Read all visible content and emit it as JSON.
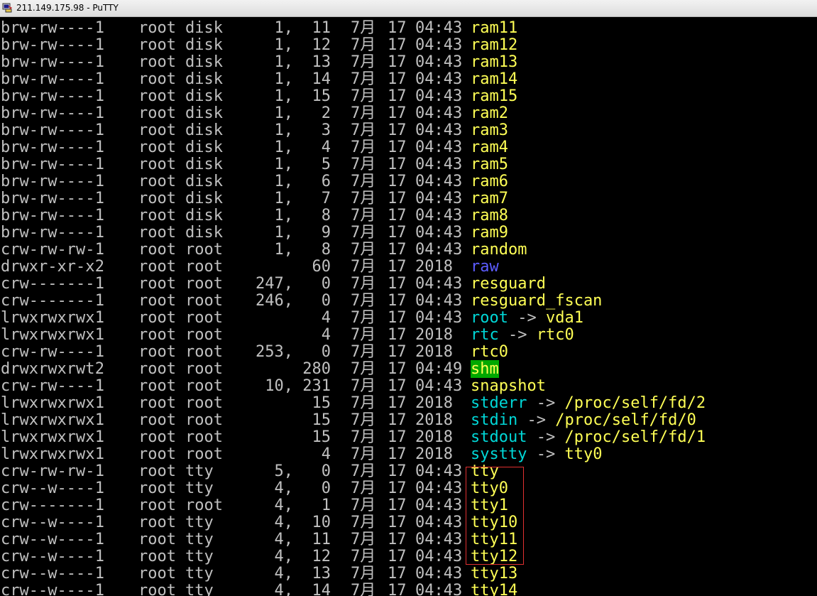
{
  "window": {
    "title": "211.149.175.98 - PuTTY",
    "icon": "putty-terminal-icon"
  },
  "colors": {
    "background": "#000000",
    "default_text": "#c0c0c0",
    "device_file": "#ffff55",
    "directory": "#5c5cff",
    "symlink": "#00d7d7",
    "sticky_dir_background": "#00a800",
    "highlight_box": "#e03030"
  },
  "listing": [
    {
      "perm": "brw-rw----",
      "links": "1",
      "owner": "root",
      "group": "disk",
      "size": "1,  11",
      "month": "7月",
      "day": "17",
      "time": "04:43",
      "name": "ram11",
      "type": "dev"
    },
    {
      "perm": "brw-rw----",
      "links": "1",
      "owner": "root",
      "group": "disk",
      "size": "1,  12",
      "month": "7月",
      "day": "17",
      "time": "04:43",
      "name": "ram12",
      "type": "dev"
    },
    {
      "perm": "brw-rw----",
      "links": "1",
      "owner": "root",
      "group": "disk",
      "size": "1,  13",
      "month": "7月",
      "day": "17",
      "time": "04:43",
      "name": "ram13",
      "type": "dev"
    },
    {
      "perm": "brw-rw----",
      "links": "1",
      "owner": "root",
      "group": "disk",
      "size": "1,  14",
      "month": "7月",
      "day": "17",
      "time": "04:43",
      "name": "ram14",
      "type": "dev"
    },
    {
      "perm": "brw-rw----",
      "links": "1",
      "owner": "root",
      "group": "disk",
      "size": "1,  15",
      "month": "7月",
      "day": "17",
      "time": "04:43",
      "name": "ram15",
      "type": "dev"
    },
    {
      "perm": "brw-rw----",
      "links": "1",
      "owner": "root",
      "group": "disk",
      "size": "1,   2",
      "month": "7月",
      "day": "17",
      "time": "04:43",
      "name": "ram2",
      "type": "dev"
    },
    {
      "perm": "brw-rw----",
      "links": "1",
      "owner": "root",
      "group": "disk",
      "size": "1,   3",
      "month": "7月",
      "day": "17",
      "time": "04:43",
      "name": "ram3",
      "type": "dev"
    },
    {
      "perm": "brw-rw----",
      "links": "1",
      "owner": "root",
      "group": "disk",
      "size": "1,   4",
      "month": "7月",
      "day": "17",
      "time": "04:43",
      "name": "ram4",
      "type": "dev"
    },
    {
      "perm": "brw-rw----",
      "links": "1",
      "owner": "root",
      "group": "disk",
      "size": "1,   5",
      "month": "7月",
      "day": "17",
      "time": "04:43",
      "name": "ram5",
      "type": "dev"
    },
    {
      "perm": "brw-rw----",
      "links": "1",
      "owner": "root",
      "group": "disk",
      "size": "1,   6",
      "month": "7月",
      "day": "17",
      "time": "04:43",
      "name": "ram6",
      "type": "dev"
    },
    {
      "perm": "brw-rw----",
      "links": "1",
      "owner": "root",
      "group": "disk",
      "size": "1,   7",
      "month": "7月",
      "day": "17",
      "time": "04:43",
      "name": "ram7",
      "type": "dev"
    },
    {
      "perm": "brw-rw----",
      "links": "1",
      "owner": "root",
      "group": "disk",
      "size": "1,   8",
      "month": "7月",
      "day": "17",
      "time": "04:43",
      "name": "ram8",
      "type": "dev"
    },
    {
      "perm": "brw-rw----",
      "links": "1",
      "owner": "root",
      "group": "disk",
      "size": "1,   9",
      "month": "7月",
      "day": "17",
      "time": "04:43",
      "name": "ram9",
      "type": "dev"
    },
    {
      "perm": "crw-rw-rw-",
      "links": "1",
      "owner": "root",
      "group": "root",
      "size": "1,   8",
      "month": "7月",
      "day": "17",
      "time": "04:43",
      "name": "random",
      "type": "dev"
    },
    {
      "perm": "drwxr-xr-x",
      "links": "2",
      "owner": "root",
      "group": "root",
      "size": "60",
      "month": "7月",
      "day": "17",
      "time": "2018",
      "name": "raw",
      "type": "dir"
    },
    {
      "perm": "crw-------",
      "links": "1",
      "owner": "root",
      "group": "root",
      "size": "247,   0",
      "month": "7月",
      "day": "17",
      "time": "04:43",
      "name": "resguard",
      "type": "dev"
    },
    {
      "perm": "crw-------",
      "links": "1",
      "owner": "root",
      "group": "root",
      "size": "246,   0",
      "month": "7月",
      "day": "17",
      "time": "04:43",
      "name": "resguard_fscan",
      "type": "dev"
    },
    {
      "perm": "lrwxrwxrwx",
      "links": "1",
      "owner": "root",
      "group": "root",
      "size": "4",
      "month": "7月",
      "day": "17",
      "time": "04:43",
      "name": "root",
      "type": "link",
      "target": "vda1"
    },
    {
      "perm": "lrwxrwxrwx",
      "links": "1",
      "owner": "root",
      "group": "root",
      "size": "4",
      "month": "7月",
      "day": "17",
      "time": "2018",
      "name": "rtc",
      "type": "link",
      "target": "rtc0"
    },
    {
      "perm": "crw-rw----",
      "links": "1",
      "owner": "root",
      "group": "root",
      "size": "253,   0",
      "month": "7月",
      "day": "17",
      "time": "2018",
      "name": "rtc0",
      "type": "dev"
    },
    {
      "perm": "drwxrwxrwt",
      "links": "2",
      "owner": "root",
      "group": "root",
      "size": "280",
      "month": "7月",
      "day": "17",
      "time": "04:49",
      "name": "shm",
      "type": "sticky"
    },
    {
      "perm": "crw-rw----",
      "links": "1",
      "owner": "root",
      "group": "root",
      "size": "10, 231",
      "month": "7月",
      "day": "17",
      "time": "04:43",
      "name": "snapshot",
      "type": "dev"
    },
    {
      "perm": "lrwxrwxrwx",
      "links": "1",
      "owner": "root",
      "group": "root",
      "size": "15",
      "month": "7月",
      "day": "17",
      "time": "2018",
      "name": "stderr",
      "type": "link",
      "target": "/proc/self/fd/2"
    },
    {
      "perm": "lrwxrwxrwx",
      "links": "1",
      "owner": "root",
      "group": "root",
      "size": "15",
      "month": "7月",
      "day": "17",
      "time": "2018",
      "name": "stdin",
      "type": "link",
      "target": "/proc/self/fd/0"
    },
    {
      "perm": "lrwxrwxrwx",
      "links": "1",
      "owner": "root",
      "group": "root",
      "size": "15",
      "month": "7月",
      "day": "17",
      "time": "2018",
      "name": "stdout",
      "type": "link",
      "target": "/proc/self/fd/1"
    },
    {
      "perm": "lrwxrwxrwx",
      "links": "1",
      "owner": "root",
      "group": "root",
      "size": "4",
      "month": "7月",
      "day": "17",
      "time": "2018",
      "name": "systty",
      "type": "link",
      "target": "tty0"
    },
    {
      "perm": "crw-rw-rw-",
      "links": "1",
      "owner": "root",
      "group": "tty",
      "size": "5,   0",
      "month": "7月",
      "day": "17",
      "time": "04:43",
      "name": "tty",
      "type": "dev"
    },
    {
      "perm": "crw--w----",
      "links": "1",
      "owner": "root",
      "group": "tty",
      "size": "4,   0",
      "month": "7月",
      "day": "17",
      "time": "04:43",
      "name": "tty0",
      "type": "dev"
    },
    {
      "perm": "crw-------",
      "links": "1",
      "owner": "root",
      "group": "root",
      "size": "4,   1",
      "month": "7月",
      "day": "17",
      "time": "04:43",
      "name": "tty1",
      "type": "dev"
    },
    {
      "perm": "crw--w----",
      "links": "1",
      "owner": "root",
      "group": "tty",
      "size": "4,  10",
      "month": "7月",
      "day": "17",
      "time": "04:43",
      "name": "tty10",
      "type": "dev"
    },
    {
      "perm": "crw--w----",
      "links": "1",
      "owner": "root",
      "group": "tty",
      "size": "4,  11",
      "month": "7月",
      "day": "17",
      "time": "04:43",
      "name": "tty11",
      "type": "dev"
    },
    {
      "perm": "crw--w----",
      "links": "1",
      "owner": "root",
      "group": "tty",
      "size": "4,  12",
      "month": "7月",
      "day": "17",
      "time": "04:43",
      "name": "tty12",
      "type": "dev"
    },
    {
      "perm": "crw--w----",
      "links": "1",
      "owner": "root",
      "group": "tty",
      "size": "4,  13",
      "month": "7月",
      "day": "17",
      "time": "04:43",
      "name": "tty13",
      "type": "dev"
    },
    {
      "perm": "crw--w----",
      "links": "1",
      "owner": "root",
      "group": "tty",
      "size": "4,  14",
      "month": "7月",
      "day": "17",
      "time": "04:43",
      "name": "tty14",
      "type": "dev"
    }
  ],
  "symlink_arrow": "->"
}
